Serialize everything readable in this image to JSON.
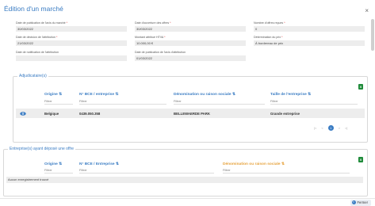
{
  "modal": {
    "title": "Édition d'un marché",
    "close": "×"
  },
  "fields": {
    "date_pub_avis": {
      "label": "Date de publication de l'avis du marché",
      "req": "*",
      "value": "30/03/2022"
    },
    "date_ouverture": {
      "label": "Date d'ouverture des offres",
      "req": "*",
      "value": "30/03/2022"
    },
    "nb_offres": {
      "label": "Nombre d'offres reçues",
      "req": "*",
      "value": "0"
    },
    "date_decision": {
      "label": "Date de décision de l'attribution",
      "req": "*",
      "value": "21/03/2022"
    },
    "montant": {
      "label": "Montant attribué HTVA",
      "req": "*",
      "value": "10.000,00 €"
    },
    "determination": {
      "label": "Détermination du prix",
      "req": "*",
      "value": "À bordereau de prix"
    },
    "date_notif": {
      "label": "Date de notification de l'attribution",
      "req": "",
      "value": ""
    },
    "date_pub_attrib": {
      "label": "Date de publication de l'avis d'attribution",
      "req": "",
      "value": "01/03/2022"
    }
  },
  "adjudicataires": {
    "title": "Adjudicataire(s)",
    "export_icon": "excel-icon",
    "columns": [
      "Origine ⇅",
      "N° BCE / entreprise ⇅",
      "Dénomination ou raison sociale ⇅",
      "Taille de l'entreprise ⇅"
    ],
    "filter_placeholder": "Filtrer",
    "rows": [
      {
        "icon": "eye-icon",
        "origine": "Belgique",
        "bce": "0439.050.358",
        "denomination": "BELLEWAERDE PARK",
        "taille": "Grande entreprise"
      }
    ],
    "pager": {
      "first": "|<",
      "prev": "<",
      "current": "1",
      "next": ">",
      "last": ">|"
    }
  },
  "entreprises": {
    "title": "Entreprise(s) ayant déposé une offre",
    "export_icon": "excel-icon",
    "columns": [
      "Origine ⇅",
      "N° BCE / Entreprise ⇅",
      "Dénomination ou raison sociale ⇅"
    ],
    "filter_placeholder": "Filtrer",
    "empty_message": "Aucun enregistrement trouvé"
  },
  "footer": {
    "close_label": "Fermer"
  },
  "colors": {
    "accent": "#3a7cc3",
    "excel": "#1f8b3a",
    "sorted_header": "#e6a23c"
  }
}
